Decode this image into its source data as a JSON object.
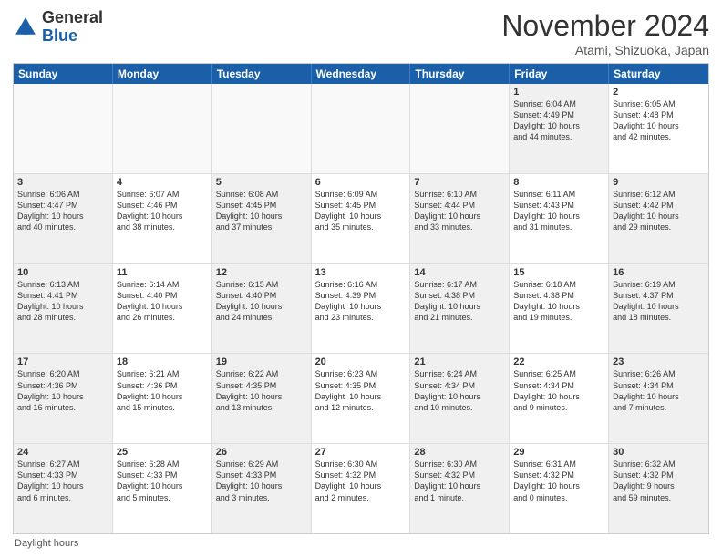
{
  "header": {
    "logo_general": "General",
    "logo_blue": "Blue",
    "month_title": "November 2024",
    "subtitle": "Atami, Shizuoka, Japan"
  },
  "days_of_week": [
    "Sunday",
    "Monday",
    "Tuesday",
    "Wednesday",
    "Thursday",
    "Friday",
    "Saturday"
  ],
  "footer": "Daylight hours",
  "weeks": [
    [
      {
        "day": "",
        "text": "",
        "empty": true
      },
      {
        "day": "",
        "text": "",
        "empty": true
      },
      {
        "day": "",
        "text": "",
        "empty": true
      },
      {
        "day": "",
        "text": "",
        "empty": true
      },
      {
        "day": "",
        "text": "",
        "empty": true
      },
      {
        "day": "1",
        "text": "Sunrise: 6:04 AM\nSunset: 4:49 PM\nDaylight: 10 hours\nand 44 minutes.",
        "shaded": true
      },
      {
        "day": "2",
        "text": "Sunrise: 6:05 AM\nSunset: 4:48 PM\nDaylight: 10 hours\nand 42 minutes.",
        "shaded": false
      }
    ],
    [
      {
        "day": "3",
        "text": "Sunrise: 6:06 AM\nSunset: 4:47 PM\nDaylight: 10 hours\nand 40 minutes.",
        "shaded": true
      },
      {
        "day": "4",
        "text": "Sunrise: 6:07 AM\nSunset: 4:46 PM\nDaylight: 10 hours\nand 38 minutes.",
        "shaded": false
      },
      {
        "day": "5",
        "text": "Sunrise: 6:08 AM\nSunset: 4:45 PM\nDaylight: 10 hours\nand 37 minutes.",
        "shaded": true
      },
      {
        "day": "6",
        "text": "Sunrise: 6:09 AM\nSunset: 4:45 PM\nDaylight: 10 hours\nand 35 minutes.",
        "shaded": false
      },
      {
        "day": "7",
        "text": "Sunrise: 6:10 AM\nSunset: 4:44 PM\nDaylight: 10 hours\nand 33 minutes.",
        "shaded": true
      },
      {
        "day": "8",
        "text": "Sunrise: 6:11 AM\nSunset: 4:43 PM\nDaylight: 10 hours\nand 31 minutes.",
        "shaded": false
      },
      {
        "day": "9",
        "text": "Sunrise: 6:12 AM\nSunset: 4:42 PM\nDaylight: 10 hours\nand 29 minutes.",
        "shaded": true
      }
    ],
    [
      {
        "day": "10",
        "text": "Sunrise: 6:13 AM\nSunset: 4:41 PM\nDaylight: 10 hours\nand 28 minutes.",
        "shaded": true
      },
      {
        "day": "11",
        "text": "Sunrise: 6:14 AM\nSunset: 4:40 PM\nDaylight: 10 hours\nand 26 minutes.",
        "shaded": false
      },
      {
        "day": "12",
        "text": "Sunrise: 6:15 AM\nSunset: 4:40 PM\nDaylight: 10 hours\nand 24 minutes.",
        "shaded": true
      },
      {
        "day": "13",
        "text": "Sunrise: 6:16 AM\nSunset: 4:39 PM\nDaylight: 10 hours\nand 23 minutes.",
        "shaded": false
      },
      {
        "day": "14",
        "text": "Sunrise: 6:17 AM\nSunset: 4:38 PM\nDaylight: 10 hours\nand 21 minutes.",
        "shaded": true
      },
      {
        "day": "15",
        "text": "Sunrise: 6:18 AM\nSunset: 4:38 PM\nDaylight: 10 hours\nand 19 minutes.",
        "shaded": false
      },
      {
        "day": "16",
        "text": "Sunrise: 6:19 AM\nSunset: 4:37 PM\nDaylight: 10 hours\nand 18 minutes.",
        "shaded": true
      }
    ],
    [
      {
        "day": "17",
        "text": "Sunrise: 6:20 AM\nSunset: 4:36 PM\nDaylight: 10 hours\nand 16 minutes.",
        "shaded": true
      },
      {
        "day": "18",
        "text": "Sunrise: 6:21 AM\nSunset: 4:36 PM\nDaylight: 10 hours\nand 15 minutes.",
        "shaded": false
      },
      {
        "day": "19",
        "text": "Sunrise: 6:22 AM\nSunset: 4:35 PM\nDaylight: 10 hours\nand 13 minutes.",
        "shaded": true
      },
      {
        "day": "20",
        "text": "Sunrise: 6:23 AM\nSunset: 4:35 PM\nDaylight: 10 hours\nand 12 minutes.",
        "shaded": false
      },
      {
        "day": "21",
        "text": "Sunrise: 6:24 AM\nSunset: 4:34 PM\nDaylight: 10 hours\nand 10 minutes.",
        "shaded": true
      },
      {
        "day": "22",
        "text": "Sunrise: 6:25 AM\nSunset: 4:34 PM\nDaylight: 10 hours\nand 9 minutes.",
        "shaded": false
      },
      {
        "day": "23",
        "text": "Sunrise: 6:26 AM\nSunset: 4:34 PM\nDaylight: 10 hours\nand 7 minutes.",
        "shaded": true
      }
    ],
    [
      {
        "day": "24",
        "text": "Sunrise: 6:27 AM\nSunset: 4:33 PM\nDaylight: 10 hours\nand 6 minutes.",
        "shaded": true
      },
      {
        "day": "25",
        "text": "Sunrise: 6:28 AM\nSunset: 4:33 PM\nDaylight: 10 hours\nand 5 minutes.",
        "shaded": false
      },
      {
        "day": "26",
        "text": "Sunrise: 6:29 AM\nSunset: 4:33 PM\nDaylight: 10 hours\nand 3 minutes.",
        "shaded": true
      },
      {
        "day": "27",
        "text": "Sunrise: 6:30 AM\nSunset: 4:32 PM\nDaylight: 10 hours\nand 2 minutes.",
        "shaded": false
      },
      {
        "day": "28",
        "text": "Sunrise: 6:30 AM\nSunset: 4:32 PM\nDaylight: 10 hours\nand 1 minute.",
        "shaded": true
      },
      {
        "day": "29",
        "text": "Sunrise: 6:31 AM\nSunset: 4:32 PM\nDaylight: 10 hours\nand 0 minutes.",
        "shaded": false
      },
      {
        "day": "30",
        "text": "Sunrise: 6:32 AM\nSunset: 4:32 PM\nDaylight: 9 hours\nand 59 minutes.",
        "shaded": true
      }
    ]
  ]
}
